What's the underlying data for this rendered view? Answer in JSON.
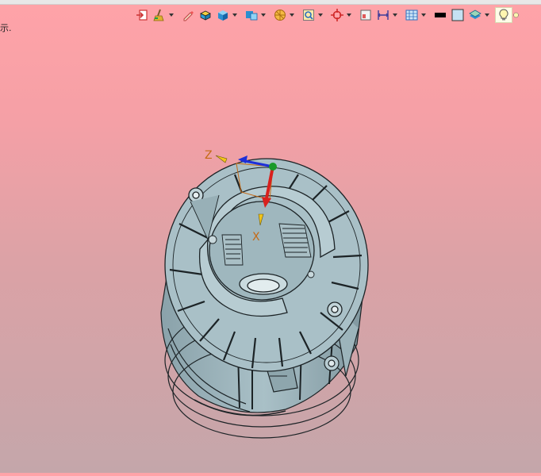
{
  "app": {
    "status_fragment": "示."
  },
  "toolbar": {
    "items": [
      {
        "name": "exit-icon",
        "has_dropdown": false
      },
      {
        "name": "broom-icon",
        "has_dropdown": true
      },
      {
        "name": "pencil-icon",
        "has_dropdown": false
      },
      {
        "name": "shaded-edges-icon",
        "has_dropdown": false
      },
      {
        "name": "cube-icon",
        "has_dropdown": true
      },
      {
        "name": "views-icon",
        "has_dropdown": true
      },
      {
        "name": "section-icon",
        "has_dropdown": true
      },
      {
        "name": "zoom-window-icon",
        "has_dropdown": true
      },
      {
        "name": "crosshair-icon",
        "has_dropdown": true
      },
      {
        "name": "frame-icon",
        "has_dropdown": false
      },
      {
        "name": "dimension-icon",
        "has_dropdown": true
      },
      {
        "name": "grid-view-icon",
        "has_dropdown": true
      },
      {
        "name": "black-swatch-icon",
        "has_dropdown": false
      },
      {
        "name": "light-blue-swatch-icon",
        "has_dropdown": false
      },
      {
        "name": "layers-icon",
        "has_dropdown": true
      },
      {
        "name": "lightbulb-icon",
        "has_dropdown": false
      }
    ]
  },
  "triad": {
    "z_label": "Z",
    "x_label": "X"
  },
  "colors": {
    "model_fill": "#a9c0c7",
    "model_edge": "#1c2326",
    "background_top": "#ffa3a8",
    "background_bottom": "#c4a6aa",
    "axis_label": "#c56a16"
  }
}
